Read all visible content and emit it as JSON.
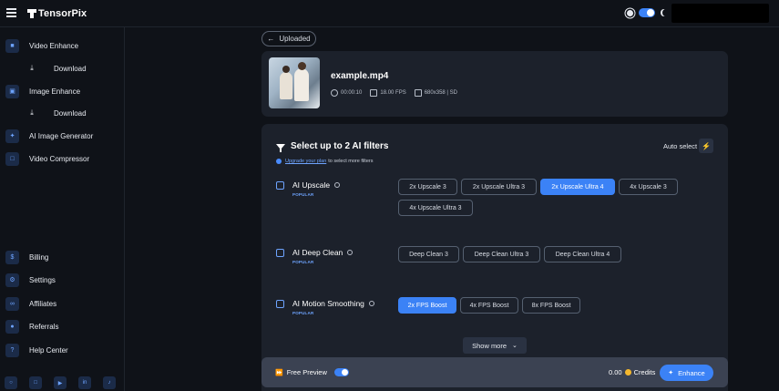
{
  "app": {
    "logo_text": "TensorPix"
  },
  "colors": {
    "accent": "#3b82f6",
    "background": "#0f1218",
    "card": "#1c212b",
    "bottom_bar": "#3b4252",
    "coin": "#f5b82e"
  },
  "theme": {
    "sun_icon": "sun-icon",
    "moon_icon": "moon-icon",
    "dark_mode_on": true
  },
  "sidebar": {
    "items": [
      {
        "label": "Video Enhance",
        "icon": "video-icon"
      },
      {
        "label": "Download",
        "icon": "download-icon"
      },
      {
        "label": "Image Enhance",
        "icon": "image-icon"
      },
      {
        "label": "Download",
        "icon": "download-icon"
      },
      {
        "label": "AI Image Generator",
        "icon": "magic-wand-icon"
      },
      {
        "label": "Video Compressor",
        "icon": "compress-icon"
      }
    ],
    "bottom_items": [
      {
        "label": "Billing",
        "icon": "dollar-icon"
      },
      {
        "label": "Settings",
        "icon": "gear-icon"
      },
      {
        "label": "Affiliates",
        "icon": "affiliates-icon"
      },
      {
        "label": "Referrals",
        "icon": "users-icon"
      },
      {
        "label": "Help Center",
        "icon": "help-icon"
      }
    ],
    "social": [
      "discord-icon",
      "instagram-icon",
      "youtube-icon",
      "linkedin-icon",
      "tiktok-icon"
    ]
  },
  "main": {
    "back_label": "Uploaded",
    "file": {
      "name": "example.mp4",
      "duration": "00:00:10",
      "fps": "18.00 FPS",
      "resolution": "680x358 | SD"
    },
    "filters": {
      "title": "Select up to 2 AI filters",
      "auto_select_label": "Auto select",
      "upgrade_link": "Upgrade your plan",
      "upgrade_rest": "to select more filters",
      "groups": [
        {
          "name": "AI Upscale",
          "badge": "POPULAR",
          "options": [
            {
              "label": "2x Upscale 3",
              "selected": false
            },
            {
              "label": "2x Upscale Ultra 3",
              "selected": false
            },
            {
              "label": "2x Upscale Ultra 4",
              "selected": true
            },
            {
              "label": "4x Upscale 3",
              "selected": false
            },
            {
              "label": "4x Upscale Ultra 3",
              "selected": false
            }
          ]
        },
        {
          "name": "AI Deep Clean",
          "badge": "POPULAR",
          "options": [
            {
              "label": "Deep Clean 3",
              "selected": false
            },
            {
              "label": "Deep Clean Ultra 3",
              "selected": false
            },
            {
              "label": "Deep Clean Ultra 4",
              "selected": false
            }
          ]
        },
        {
          "name": "AI Motion Smoothing",
          "badge": "POPULAR",
          "options": [
            {
              "label": "2x FPS Boost",
              "selected": true
            },
            {
              "label": "4x FPS Boost",
              "selected": false
            },
            {
              "label": "8x FPS Boost",
              "selected": false
            }
          ]
        }
      ],
      "show_more_label": "Show more"
    }
  },
  "bottom_bar": {
    "free_preview_label": "Free Preview",
    "free_preview_on": true,
    "credits_value": "0.00",
    "credits_label": "Credits",
    "enhance_label": "Enhance"
  }
}
